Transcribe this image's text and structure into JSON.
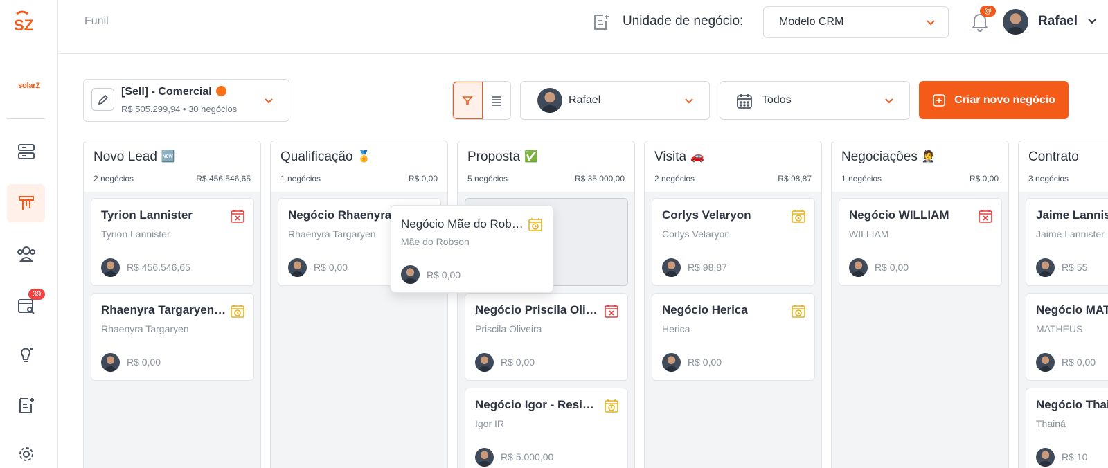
{
  "sidebar": {
    "brand_text": "solarZ",
    "items": [
      {
        "icon": "server-icon"
      },
      {
        "icon": "funnel-board-icon",
        "active": true
      },
      {
        "icon": "users-icon"
      },
      {
        "icon": "calendar-search-icon",
        "badge": "39"
      },
      {
        "icon": "lightbulb-icon"
      },
      {
        "icon": "note-add-icon"
      },
      {
        "icon": "gear-icon"
      }
    ]
  },
  "topbar": {
    "breadcrumb": "Funil",
    "unit_label": "Unidade de negócio:",
    "unit_value": "Modelo CRM",
    "notification_badge": "@",
    "user_name": "Rafael"
  },
  "toolbar": {
    "pipeline_name": "[Sell] - Comercial",
    "pipeline_summary": "R$ 505.299,94 • 30 negócios",
    "owner_name": "Rafael",
    "period_value": "Todos",
    "create_label": "Criar novo negócio"
  },
  "colors": {
    "accent": "#f45a18",
    "overdue": "#e53e3e",
    "pending": "#e6b21a"
  },
  "columns": [
    {
      "title": "Novo Lead",
      "emoji": "🆕",
      "count": "2 negócios",
      "total": "R$ 456.546,65",
      "cards": [
        {
          "title": "Tyrion Lannister",
          "subtitle": "Tyrion Lannister",
          "value": "R$ 456.546,65",
          "status": "overdue"
        },
        {
          "title": "Rhaenyra Targaryen - ...",
          "subtitle": "Rhaenyra Targaryen",
          "value": "R$ 0,00",
          "status": "pending"
        }
      ]
    },
    {
      "title": "Qualificação",
      "emoji": "🏅",
      "count": "1 negócios",
      "total": "R$ 0,00",
      "cards": [
        {
          "title": "Negócio Rhaenyra T",
          "subtitle": "Rhaenyra Targaryen",
          "value": "R$ 0,00",
          "status": "none"
        }
      ]
    },
    {
      "title": "Proposta",
      "emoji": "✅",
      "count": "5 negócios",
      "total": "R$ 35.000,00",
      "cards": [
        {
          "title": "Negócio Priscila Olive...",
          "subtitle": "Priscila Oliveira",
          "value": "R$ 0,00",
          "status": "overdue"
        },
        {
          "title": "Negócio Igor - Reside...",
          "subtitle": "Igor IR",
          "value": "R$ 5.000,00",
          "status": "pending"
        }
      ]
    },
    {
      "title": "Visita",
      "emoji": "🚗",
      "count": "2 negócios",
      "total": "R$ 98,87",
      "cards": [
        {
          "title": "Corlys Velaryon",
          "subtitle": "Corlys Velaryon",
          "value": "R$ 98,87",
          "status": "pending"
        },
        {
          "title": "Negócio Herica",
          "subtitle": "Herica",
          "value": "R$ 0,00",
          "status": "pending"
        }
      ]
    },
    {
      "title": "Negociações",
      "emoji": "🤵",
      "count": "1 negócios",
      "total": "R$ 0,00",
      "cards": [
        {
          "title": "Negócio WILLIAM",
          "subtitle": "WILLIAM",
          "value": "R$ 0,00",
          "status": "overdue"
        }
      ]
    },
    {
      "title": "Contrato",
      "emoji": "",
      "count": "3 negócios",
      "total": "",
      "cards": [
        {
          "title": "Jaime Lannister",
          "subtitle": "Jaime Lannister",
          "value": "R$ 55",
          "status": "none"
        },
        {
          "title": "Negócio MATHEUS",
          "subtitle": "MATHEUS",
          "value": "R$ 0,00",
          "status": "none"
        },
        {
          "title": "Negócio Thainá",
          "subtitle": "Thainá",
          "value": "R$ 10",
          "status": "none"
        }
      ]
    }
  ],
  "dragging_card": {
    "title": "Negócio Mãe do Robson",
    "subtitle": "Mãe do Robson",
    "value": "R$ 0,00",
    "status": "pending"
  }
}
